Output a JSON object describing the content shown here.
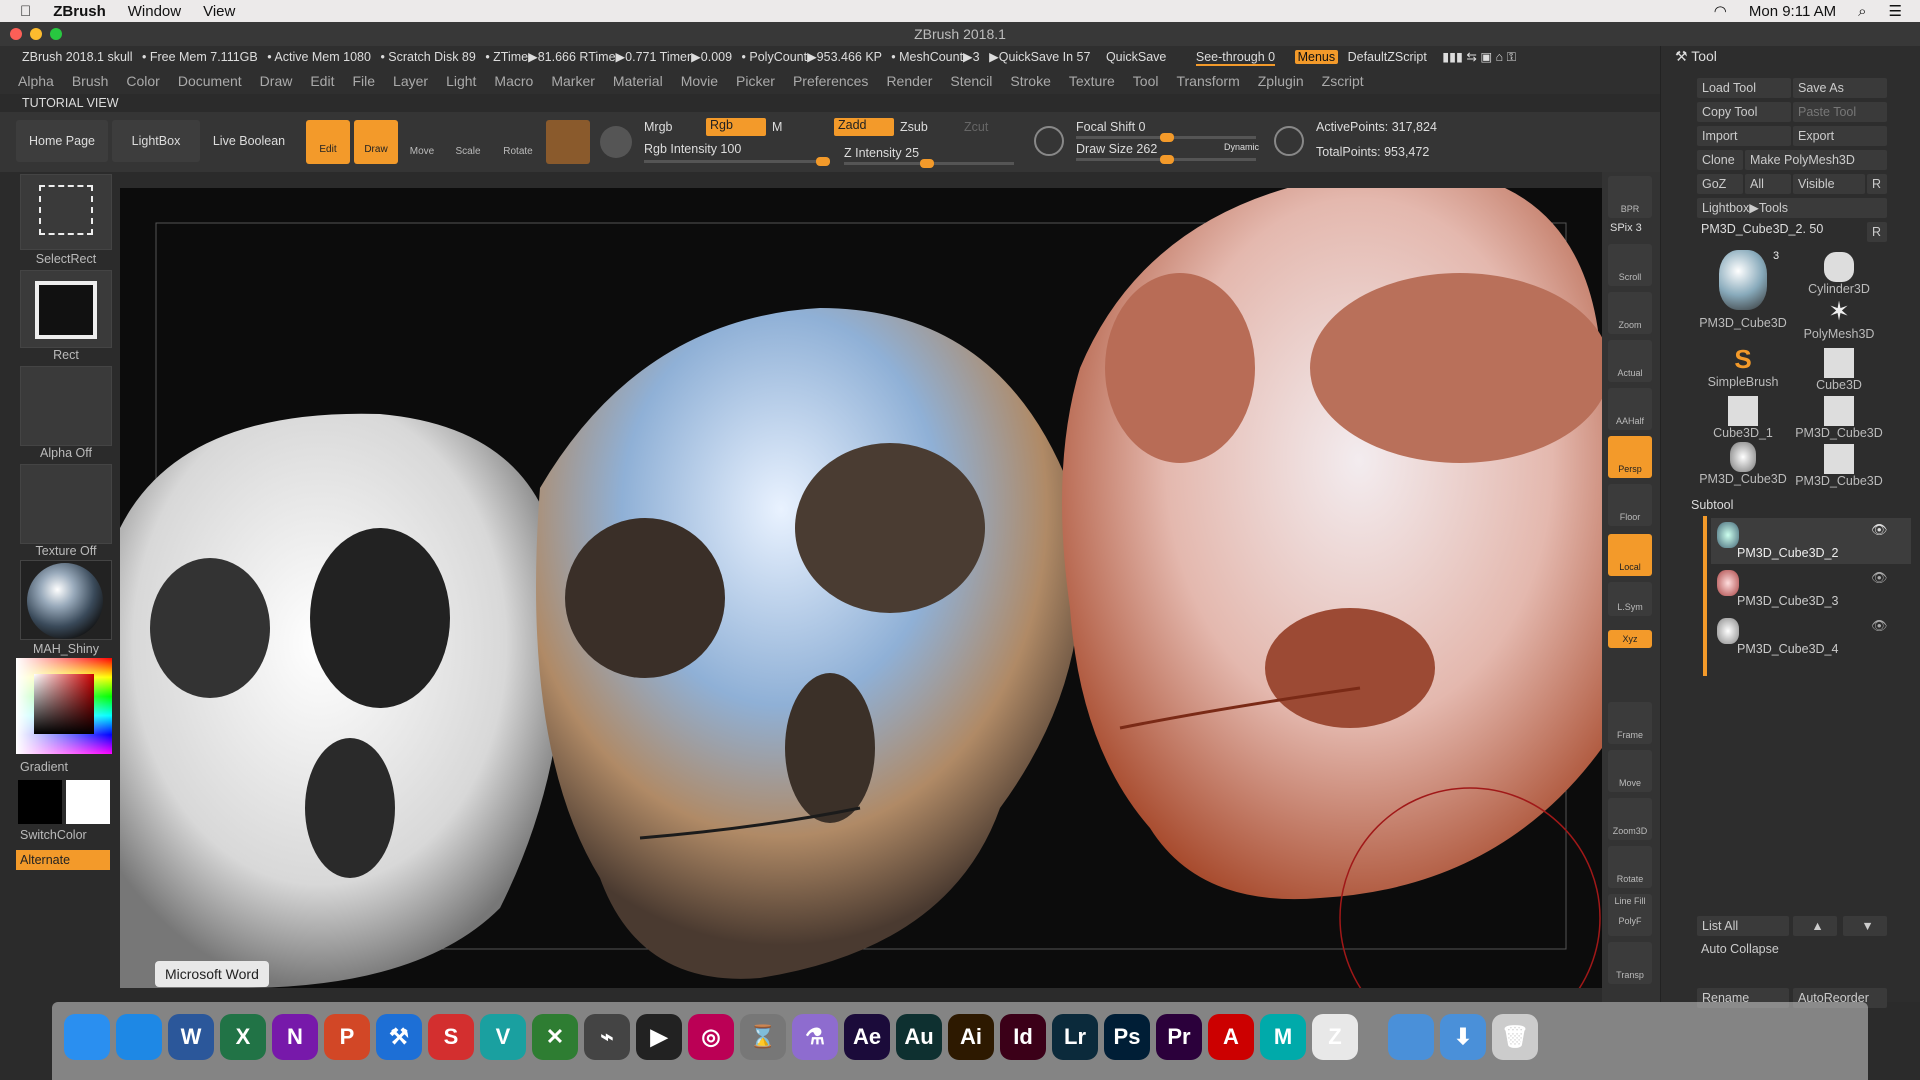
{
  "menubar": {
    "app": "ZBrush",
    "items": [
      "Window",
      "View"
    ],
    "clock": "Mon 9:11 AM"
  },
  "window_title": "ZBrush 2018.1",
  "status": {
    "doc": "ZBrush 2018.1 skull",
    "free_mem": "• Free Mem 7.111GB",
    "active_mem": "• Active Mem 1080",
    "scratch": "• Scratch Disk 89",
    "ztime": "• ZTime▶81.666 RTime▶0.771 Timer▶0.009",
    "polycount": "• PolyCount▶953.466 KP",
    "meshcount": "• MeshCount▶3",
    "quicksave_in": "▶QuickSave In 57",
    "quicksave": "QuickSave",
    "see_through": "See-through 0",
    "menus": "Menus",
    "zscript": "DefaultZScript"
  },
  "menus": [
    "Alpha",
    "Brush",
    "Color",
    "Document",
    "Draw",
    "Edit",
    "File",
    "Layer",
    "Light",
    "Macro",
    "Marker",
    "Material",
    "Movie",
    "Picker",
    "Preferences",
    "Render",
    "Stencil",
    "Stroke",
    "Texture",
    "Tool",
    "Transform",
    "Zplugin",
    "Zscript"
  ],
  "tutorial_view": "TUTORIAL VIEW",
  "toolbar": {
    "home_page": "Home Page",
    "lightbox": "LightBox",
    "live_boolean": "Live Boolean",
    "edit": "Edit",
    "draw": "Draw",
    "move": "Move",
    "scale": "Scale",
    "rotate": "Rotate",
    "mrgb": "Mrgb",
    "rgb": "Rgb",
    "m": "M",
    "zadd": "Zadd",
    "zsub": "Zsub",
    "zcut": "Zcut",
    "rgb_intensity": "Rgb Intensity 100",
    "z_intensity": "Z Intensity 25",
    "focal_shift": "Focal Shift 0",
    "draw_size": "Draw Size 262",
    "dynamic": "Dynamic",
    "active_points": "ActivePoints: 317,824",
    "total_points": "TotalPoints: 953,472",
    "rgb_intensity_value": 100,
    "z_intensity_value": 25,
    "focal_shift_value": 0,
    "draw_size_value": 262
  },
  "left_shelf": {
    "select_rect": "SelectRect",
    "rect": "Rect",
    "alpha": "Alpha Off",
    "texture": "Texture Off",
    "material": "MAH_Shiny",
    "gradient": "Gradient",
    "switch_color": "SwitchColor",
    "alternate": "Alternate"
  },
  "right_tray": [
    "BPR",
    "SPix 3",
    "Scroll",
    "Zoom",
    "Actual",
    "AAHalf",
    "Persp",
    "Floor",
    "Local",
    "L.Sym",
    "Xyz",
    "Frame",
    "Move",
    "Zoom3D",
    "Rotate",
    "Line Fill",
    "PolyF",
    "Transp"
  ],
  "tool_panel": {
    "title": "Tool",
    "load_tool": "Load Tool",
    "save_as": "Save As",
    "copy_tool": "Copy Tool",
    "paste_tool": "Paste Tool",
    "import": "Import",
    "export": "Export",
    "clone": "Clone",
    "make_polymesh": "Make PolyMesh3D",
    "goz": "GoZ",
    "all": "All",
    "visible": "Visible",
    "r": "R",
    "lightbox_tools": "Lightbox▶Tools",
    "current_tool": "PM3D_Cube3D_2. 50",
    "tools": [
      "PM3D_Cube3D",
      "Cylinder3D",
      "PolyMesh3D",
      "SimpleBrush",
      "Cube3D",
      "Cube3D_1",
      "PM3D_Cube3D",
      "PM3D_Cube3D",
      "PM3D_Cube3D"
    ],
    "tool_badge": "3",
    "subtool_title": "Subtool",
    "subtools": [
      "PM3D_Cube3D_2",
      "PM3D_Cube3D_3",
      "PM3D_Cube3D_4"
    ],
    "list_all": "List All",
    "auto_collapse": "Auto Collapse",
    "rename": "Rename",
    "auto_reorder": "AutoReorder"
  },
  "dock": {
    "tooltip": "Microsoft Word",
    "apps": [
      "Finder",
      "Safari",
      "Word",
      "Excel",
      "OneNote",
      "PowerPoint",
      "Xcode",
      "SketchUp",
      "Vectorworks",
      "Rhino",
      "Motion",
      "Final Cut Pro",
      "Colors",
      "Compressor",
      "Automator",
      "After Effects",
      "Audition",
      "Illustrator",
      "InDesign",
      "Lightroom",
      "Photoshop",
      "Premiere",
      "Acrobat",
      "Maya",
      "ZBrush",
      "Applications",
      "Downloads",
      "Trash"
    ],
    "labels": [
      "",
      "",
      "W",
      "X",
      "N",
      "P",
      "⚒",
      "S",
      "V",
      "✕",
      "⌁",
      "▶",
      "◎",
      "⌛",
      "⚗",
      "Ae",
      "Au",
      "Ai",
      "Id",
      "Lr",
      "Ps",
      "Pr",
      "A",
      "M",
      "Z",
      "",
      "⬇",
      "🗑"
    ]
  },
  "colors": {
    "accent": "#f39a2a",
    "panel": "#2d2d2d",
    "canvas": "#0c0c0c"
  }
}
